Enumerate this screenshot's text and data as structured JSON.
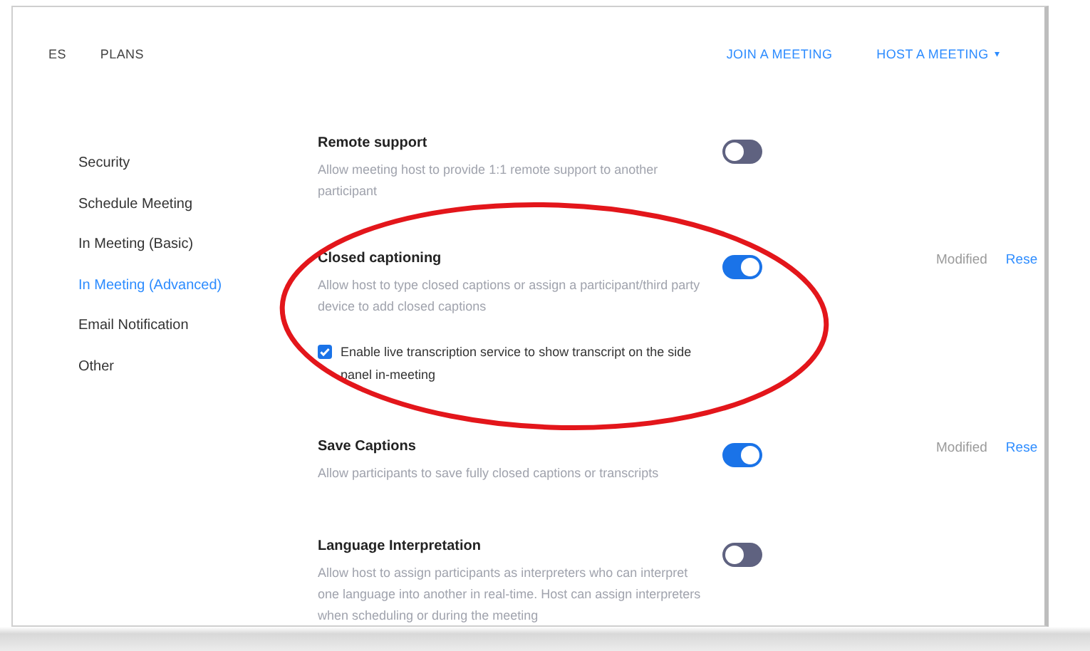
{
  "nav": {
    "left": [
      {
        "label": "ES"
      },
      {
        "label": "PLANS"
      }
    ],
    "right": [
      {
        "label": "JOIN A MEETING",
        "dropdown": false
      },
      {
        "label": "HOST A MEETING",
        "dropdown": true,
        "caret": "▾"
      }
    ]
  },
  "sidebar": {
    "items": [
      {
        "label": "Security",
        "selected": false
      },
      {
        "label": "Schedule Meeting",
        "selected": false
      },
      {
        "label": "In Meeting (Basic)",
        "selected": false
      },
      {
        "label": "In Meeting (Advanced)",
        "selected": true
      },
      {
        "label": "Email Notification",
        "selected": false
      },
      {
        "label": "Other",
        "selected": false
      }
    ]
  },
  "settings": [
    {
      "title": "Remote support",
      "description": "Allow meeting host to provide 1:1 remote support to another participant",
      "on": false
    },
    {
      "title": "Closed captioning",
      "description": "Allow host to type closed captions or assign a participant/third party device to add closed captions",
      "on": true,
      "status": "Modified",
      "reset": "Rese",
      "option": {
        "label": "Enable live transcription service to show transcript on the side panel in-meeting",
        "checked": true
      }
    },
    {
      "title": "Save Captions",
      "description": "Allow participants to save fully closed captions or transcripts",
      "on": true,
      "status": "Modified",
      "reset": "Rese"
    },
    {
      "title": "Language Interpretation",
      "description": "Allow host to assign participants as interpreters who can interpret one language into another in real-time. Host can assign interpreters when scheduling or during the meeting",
      "on": false
    }
  ],
  "annotation": {
    "kind": "ellipse",
    "color": "#e3161b"
  }
}
